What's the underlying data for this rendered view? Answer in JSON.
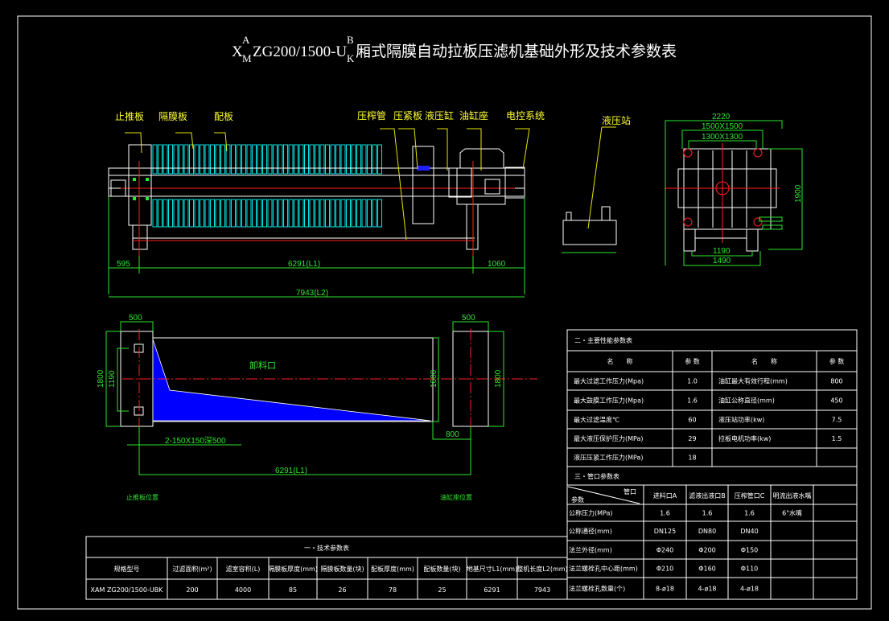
{
  "title": {
    "prefix": "X",
    "sup1": "A",
    "sub1": "M",
    "model": "ZG200/1500-U",
    "sup2": "B",
    "sub2": "K",
    "name": "厢式隔膜自动拉板压滤机基础外形及技术参数表"
  },
  "main_view": {
    "labels": [
      "止推板",
      "隔膜板",
      "配板",
      "压榨管",
      "压紧板",
      "液压缸",
      "油缸座",
      "电控系统"
    ],
    "dims": {
      "left": "595",
      "middle": "6291(L1)",
      "right": "1060",
      "total": "7943(L2)"
    }
  },
  "hydraulic_station": {
    "label": "液压站"
  },
  "side_view": {
    "dims": {
      "width_total": "2220",
      "plate_outer": "1500X1500",
      "plate_inner": "1300X1300",
      "height": "1900",
      "foot_inner": "1190",
      "foot_outer": "1490"
    }
  },
  "foundation_plan": {
    "discharge_label": "卸料口",
    "dims": {
      "left_width": "500",
      "right_width": "500",
      "left_height": "1800",
      "left_bolt": "1190",
      "pit_height": "1600",
      "right_height": "1800",
      "offset": "800",
      "length": "6291(L1)",
      "holes": "2-150X150深500"
    },
    "left_position": "止推板位置",
    "right_position": "油缸座位置"
  },
  "table_tech": {
    "title": "一・技术参数表",
    "headers": [
      "规格型号",
      "过滤面积(m²)",
      "滤室容积(L)",
      "隔膜板厚度(mm)",
      "隔膜板数量(块)",
      "配板厚度(mm)",
      "配板数量(块)",
      "地基尺寸L1(mm)",
      "整机长度L2(mm)"
    ],
    "row": [
      "XAM ZG200/1500-UBK",
      "200",
      "4000",
      "85",
      "26",
      "78",
      "25",
      "6291",
      "7943"
    ]
  },
  "table_perf": {
    "title": "二・主要性能参数表",
    "headers": [
      "名　　称",
      "参 数",
      "名　　称",
      "参 数"
    ],
    "rows": [
      [
        "最大过滤工作压力(Mpa)",
        "1.0",
        "油缸最大有效行程(mm)",
        "800"
      ],
      [
        "最大鼓膜工作压力(Mpa)",
        "1.6",
        "油缸公称直径(mm)",
        "450"
      ],
      [
        "最大过滤温度℃",
        "60",
        "液压站功率(kw)",
        "7.5"
      ],
      [
        "最大液压保护压力(MPa)",
        "29",
        "拉板电机功率(kw)",
        "1.5"
      ],
      [
        "液压压紧工作压力(MPa)",
        "18",
        "",
        ""
      ]
    ]
  },
  "table_ports": {
    "title": "三・管口参数表",
    "corner_top": "管口",
    "corner_bottom": "参数",
    "headers": [
      "进料口A",
      "滤液出液口B",
      "压榨管口C",
      "明流出液水嘴",
      ""
    ],
    "rows": [
      [
        "公称压力(MPa)",
        "1.6",
        "1.6",
        "1.6",
        "6\"水嘴",
        ""
      ],
      [
        "公称通径(mm)",
        "DN125",
        "DN80",
        "DN40",
        "",
        ""
      ],
      [
        "法兰外径(mm)",
        "Φ240",
        "Φ200",
        "Φ150",
        "",
        ""
      ],
      [
        "法兰螺栓孔中心距(mm)",
        "Φ210",
        "Φ160",
        "Φ110",
        "",
        ""
      ],
      [
        "法兰螺栓孔数量(个)",
        "8-ø18",
        "4-ø18",
        "4-ø18",
        "",
        ""
      ]
    ]
  },
  "colors": {
    "background": "#000000",
    "outline": "#ffffff",
    "dimension": "#2ee62e",
    "leader": "#e6e600",
    "plates": "#00e6e6",
    "centerline": "#ff2020",
    "pit_fill": "#0000ff"
  }
}
